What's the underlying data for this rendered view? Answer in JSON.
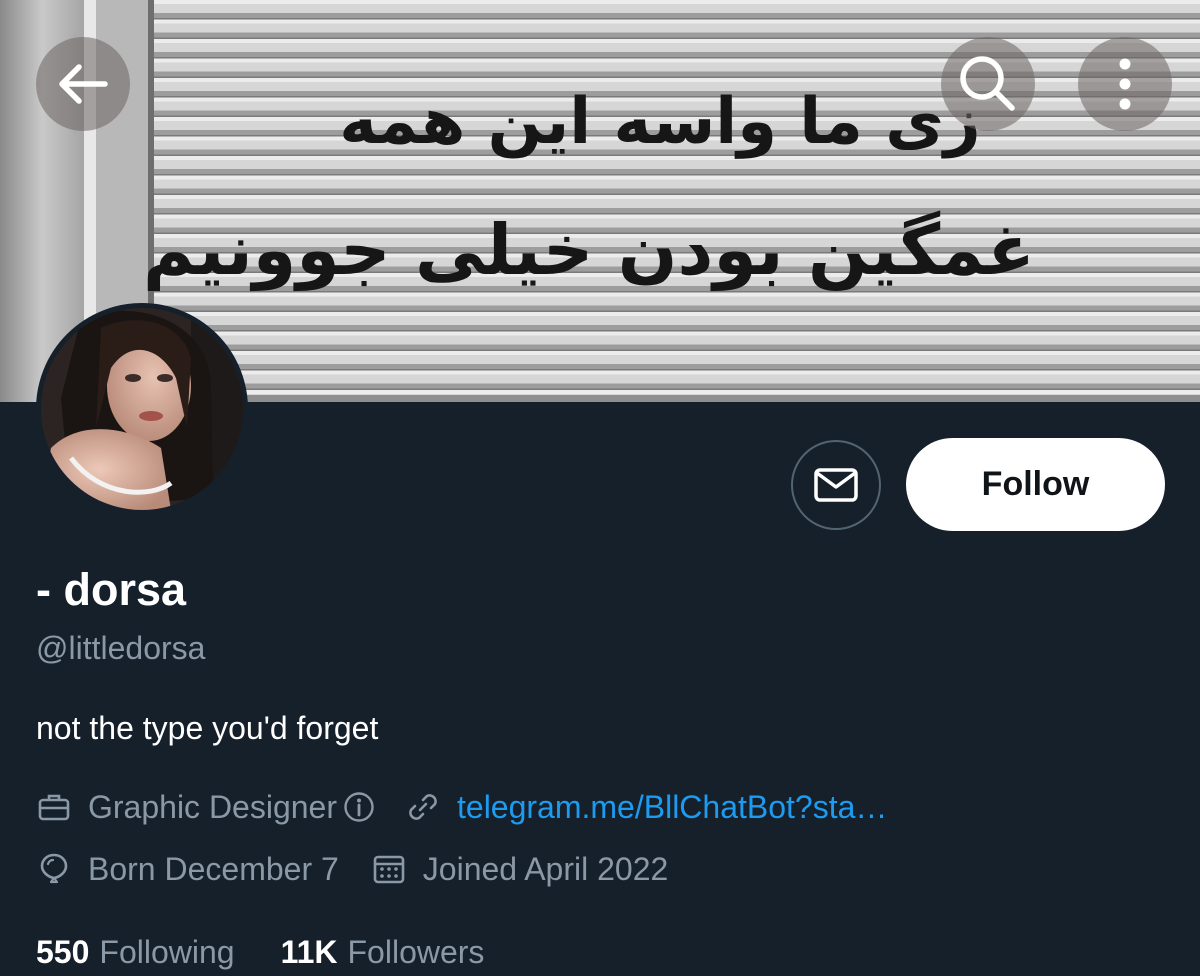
{
  "header": {
    "back_icon": "arrow-left-icon",
    "search_icon": "search-icon",
    "more_icon": "more-vertical-icon"
  },
  "banner": {
    "text_line_1": "زی ما واسه این همه",
    "text_line_2": "غمگین بودن خیلی جوونیم"
  },
  "actions": {
    "message_icon": "envelope-icon",
    "follow_label": "Follow"
  },
  "profile": {
    "display_name": "- dorsa",
    "handle": "@littledorsa",
    "bio": "not the type you'd forget",
    "profession": "Graphic Designer",
    "link_text": "telegram.me/BllChatBot?sta…",
    "birthday": "Born December 7",
    "joined": "Joined April 2022"
  },
  "stats": {
    "following_count": "550",
    "following_label": "Following",
    "followers_count": "11K",
    "followers_label": "Followers"
  },
  "colors": {
    "background": "#15202b",
    "secondary_text": "#8b98a5",
    "link": "#1d9bf0",
    "follow_button_bg": "#ffffff"
  }
}
